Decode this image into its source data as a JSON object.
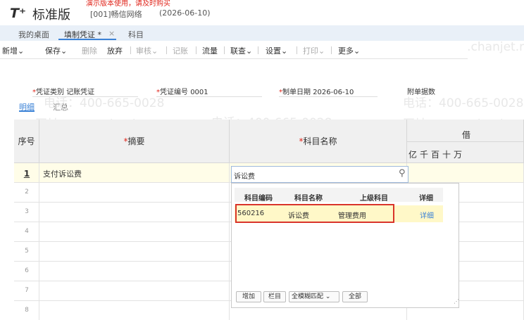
{
  "header": {
    "logo": "T⁺",
    "product": "标准版",
    "demo_notice": "演示版本使用，请及时购买",
    "demo_link": "购买",
    "org": "[001]畅信网络",
    "date": "(2026-06-10)"
  },
  "tabs": [
    {
      "label": "我的桌面"
    },
    {
      "label": "填制凭证 *"
    },
    {
      "label": "科目"
    }
  ],
  "tab_close": "×",
  "toolbar": [
    {
      "label": "新增"
    },
    {
      "label": "保存"
    },
    {
      "label": "删除"
    },
    {
      "label": "放弃"
    },
    {
      "label": "审核"
    },
    {
      "label": "记账"
    },
    {
      "label": "流量"
    },
    {
      "label": "联查"
    },
    {
      "label": "设置"
    },
    {
      "label": "打印"
    },
    {
      "label": "更多"
    }
  ],
  "form": {
    "type_label": "凭证类别",
    "type_value": "记账凭证",
    "no_label": "凭证编号",
    "no_value": "0001",
    "date_label": "制单日期",
    "date_value": "2026-06-10",
    "attach_label": "附单据数"
  },
  "subtabs": [
    {
      "label": "明细"
    },
    {
      "label": "汇总"
    }
  ],
  "grid": {
    "col_seq": "序号",
    "col_summary": "摘要",
    "col_account": "科目名称",
    "col_debit": "借",
    "digits": [
      "亿",
      "千",
      "百",
      "十",
      "万"
    ],
    "rows": [
      {
        "seq": "1",
        "summary": "支付诉讼费",
        "account": "诉讼费"
      },
      {
        "seq": "2"
      },
      {
        "seq": "3"
      },
      {
        "seq": "4"
      },
      {
        "seq": "5"
      },
      {
        "seq": "6"
      },
      {
        "seq": "7"
      },
      {
        "seq": "8"
      }
    ]
  },
  "search_placeholder": "诉讼费",
  "popup": {
    "headers": [
      "科目编码",
      "科目名称",
      "上级科目",
      "详细"
    ],
    "row": {
      "code": "560216",
      "name": "诉讼费",
      "parent": "管理费用",
      "detail": "详细"
    },
    "buttons": {
      "add": "增加",
      "col": "栏目",
      "match": "全模糊匹配",
      "all": "全部"
    }
  },
  "watermark": {
    "phone": "电话：400-665-0028",
    "site": "网址：www.chanjet.net"
  },
  "colors": {
    "accent": "#3b82d6",
    "required": "#e0251b",
    "highlight_border": "#d9342b",
    "selected_row": "#fff8c8"
  }
}
